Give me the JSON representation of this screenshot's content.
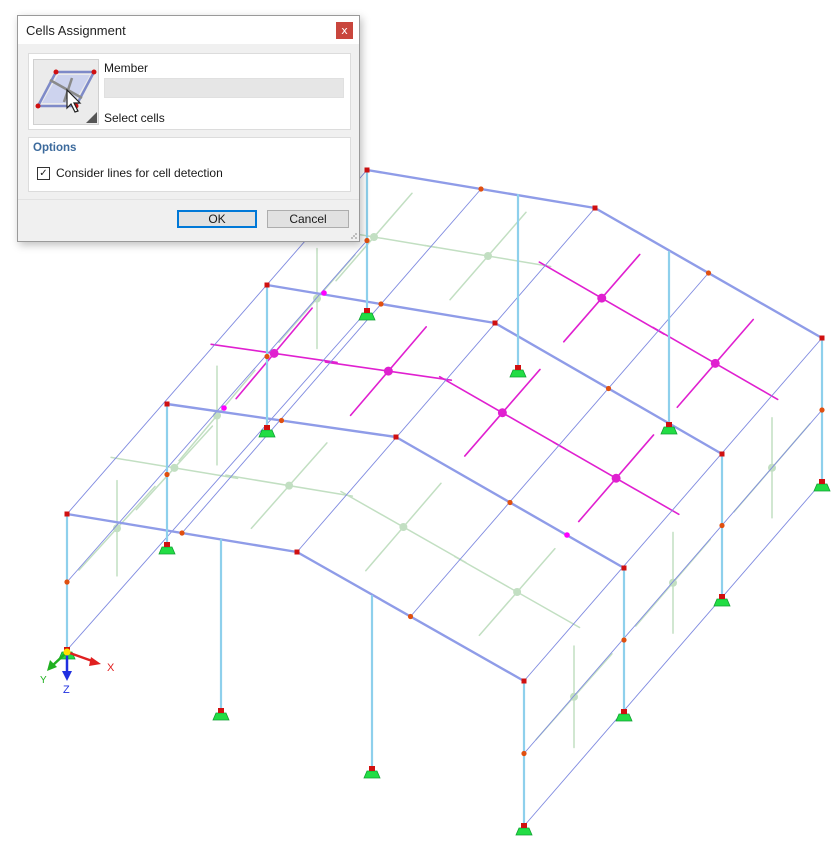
{
  "dialog": {
    "title": "Cells Assignment",
    "close_glyph": "x",
    "member_label": "Member",
    "member_value": "",
    "select_label": "Select cells",
    "options_header": "Options",
    "consider_lines_label": "Consider lines for cell detection",
    "consider_lines_checked": true,
    "ok_label": "OK",
    "cancel_label": "Cancel"
  },
  "axes": {
    "x_label": "X",
    "y_label": "Y",
    "z_label": "Z"
  },
  "icons": [
    "close-icon",
    "select-cells-icon",
    "cursor-icon",
    "check-icon",
    "resize-grip-icon",
    "support-icon"
  ],
  "colors": {
    "member": "#8f9ce8",
    "column": "#8ed0ec",
    "grid_line": "#7f8ae0",
    "selected_cell": "#e020d0",
    "unselected_cell": "#c2dfc2",
    "node": "#e05010",
    "node_selected": "#ff00ff",
    "support": "#22dd44",
    "accent": "#0078d7",
    "close": "#c9463d",
    "options_header": "#3c6a9c"
  }
}
